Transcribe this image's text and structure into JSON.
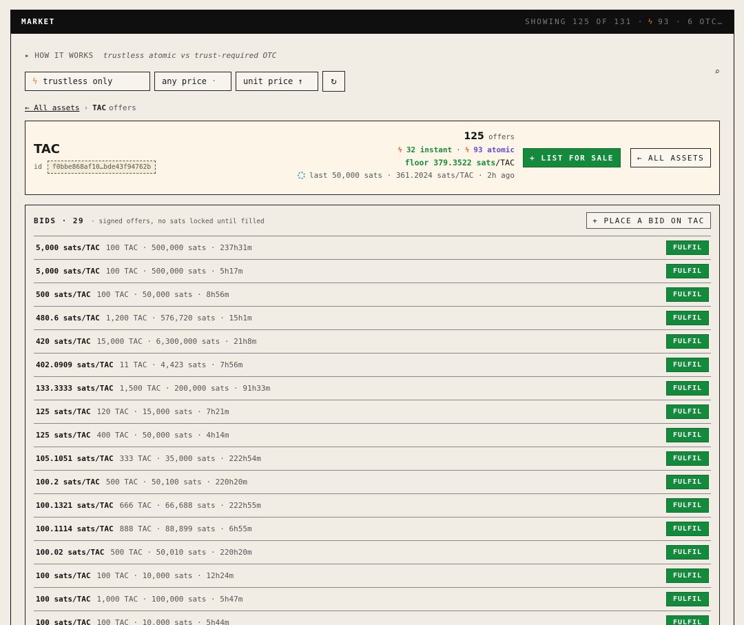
{
  "topbar": {
    "title": "MARKET",
    "showing": "SHOWING 125 OF 131 ·",
    "atomic_count": "93 · 6 OTC…"
  },
  "how_it_works": {
    "link": "HOW IT WORKS",
    "subtitle": "trustless atomic vs trust-required OTC"
  },
  "filters": {
    "trustless": "trustless only",
    "price": "any price",
    "sort": "unit price ↑",
    "refresh": "↻"
  },
  "breadcrumb": {
    "back": "← All assets",
    "sep": "›",
    "asset": "TAC",
    "suffix": "offers"
  },
  "asset": {
    "name": "TAC",
    "id_label": "id",
    "id_value": "f0bbe868af10…bde43f94762b",
    "offers_count": "125",
    "offers_label": "offers",
    "instant": "32 instant",
    "atomic": "93 atomic",
    "floor": "floor 379.3522 sats",
    "floor_unit": "/TAC",
    "last_sale": "last 50,000 sats · 361.2024 sats/TAC · 2h ago",
    "list_button": "+ LIST FOR SALE",
    "all_assets_button": "← ALL ASSETS"
  },
  "bids": {
    "title": "BIDS · 29",
    "note": "· signed offers, no sats locked until filled",
    "place_bid": "+ PLACE A BID ON TAC",
    "fulfil_label": "FULFIL",
    "rows": [
      {
        "price": "5,000 sats/TAC",
        "detail": "100 TAC · 500,000 sats · 237h31m"
      },
      {
        "price": "5,000 sats/TAC",
        "detail": "100 TAC · 500,000 sats · 5h17m"
      },
      {
        "price": "500 sats/TAC",
        "detail": "100 TAC · 50,000 sats · 8h56m"
      },
      {
        "price": "480.6 sats/TAC",
        "detail": "1,200 TAC · 576,720 sats · 15h1m"
      },
      {
        "price": "420 sats/TAC",
        "detail": "15,000 TAC · 6,300,000 sats · 21h8m"
      },
      {
        "price": "402.0909 sats/TAC",
        "detail": "11 TAC · 4,423 sats · 7h56m"
      },
      {
        "price": "133.3333 sats/TAC",
        "detail": "1,500 TAC · 200,000 sats · 91h33m"
      },
      {
        "price": "125 sats/TAC",
        "detail": "120 TAC · 15,000 sats · 7h21m"
      },
      {
        "price": "125 sats/TAC",
        "detail": "400 TAC · 50,000 sats · 4h14m"
      },
      {
        "price": "105.1051 sats/TAC",
        "detail": "333 TAC · 35,000 sats · 222h54m"
      },
      {
        "price": "100.2 sats/TAC",
        "detail": "500 TAC · 50,100 sats · 220h20m"
      },
      {
        "price": "100.1321 sats/TAC",
        "detail": "666 TAC · 66,688 sats · 222h55m"
      },
      {
        "price": "100.1114 sats/TAC",
        "detail": "888 TAC · 88,899 sats · 6h55m"
      },
      {
        "price": "100.02 sats/TAC",
        "detail": "500 TAC · 50,010 sats · 220h20m"
      },
      {
        "price": "100 sats/TAC",
        "detail": "100 TAC · 10,000 sats · 12h24m"
      },
      {
        "price": "100 sats/TAC",
        "detail": "1,000 TAC · 100,000 sats · 5h47m"
      },
      {
        "price": "100 sats/TAC",
        "detail": "100 TAC · 10,000 sats · 5h44m"
      }
    ]
  },
  "colors": {
    "accent_green": "#148a3c",
    "atomic_purple": "#6c46d8",
    "bolt_orange": "#e8763a",
    "card_bg": "#fdf6e8"
  }
}
